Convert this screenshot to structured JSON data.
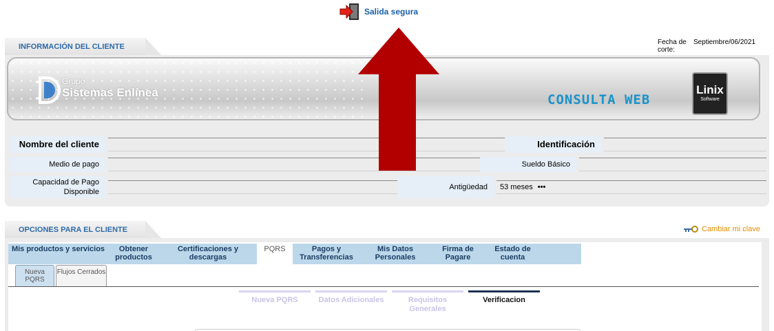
{
  "logout": {
    "label": "Salida segura"
  },
  "client_section": {
    "title": "INFORMACIÓN DEL CLIENTE",
    "fecha_label": "Fecha de corte:",
    "fecha_value": "Septiembre/06/2021"
  },
  "banner": {
    "brand_small": "Grupo",
    "brand_big": "Sistemas Enlínea",
    "product": "CONSULTA WEB",
    "vendor": "Linix",
    "vendor_sub": "Software"
  },
  "client_fields": {
    "nombre_label": "Nombre del cliente",
    "nombre_value": "",
    "identificacion_label": "Identificación",
    "identificacion_value": "",
    "medio_label": "Medio de pago",
    "medio_value": "",
    "sueldo_label": "Sueldo Básico",
    "sueldo_value": "",
    "capacidad_label": "Capacidad de Pago Disponible",
    "capacidad_value": "",
    "antiguedad_label": "Antigüedad",
    "antiguedad_value": "53 meses",
    "antiguedad_more": "•••"
  },
  "options_section": {
    "title": "OPCIONES PARA EL CLIENTE",
    "change_password": "Cambiar mi clave"
  },
  "tabs": [
    {
      "label": "Mis productos y servicios"
    },
    {
      "label": "Obtener productos"
    },
    {
      "label": "Certificaciones y descargas"
    },
    {
      "label": "PQRS"
    },
    {
      "label": "Pagos y Transferencias"
    },
    {
      "label": "Mis Datos Personales"
    },
    {
      "label": "Firma de Pagare"
    },
    {
      "label": "Estado de cuenta"
    }
  ],
  "subtabs": [
    {
      "label": "Nueva PQRS"
    },
    {
      "label": "Flujos Cerrados"
    }
  ],
  "steps": [
    {
      "label": "Nueva PQRS"
    },
    {
      "label": "Datos Adicionales"
    },
    {
      "label": "Requisitos Generales"
    },
    {
      "label": "Verificacion"
    }
  ],
  "colors": {
    "accent_blue": "#2d6aa9",
    "tab_bg": "#bcd7ea",
    "arrow_red": "#b20000",
    "clave_orange": "#e08c00"
  }
}
